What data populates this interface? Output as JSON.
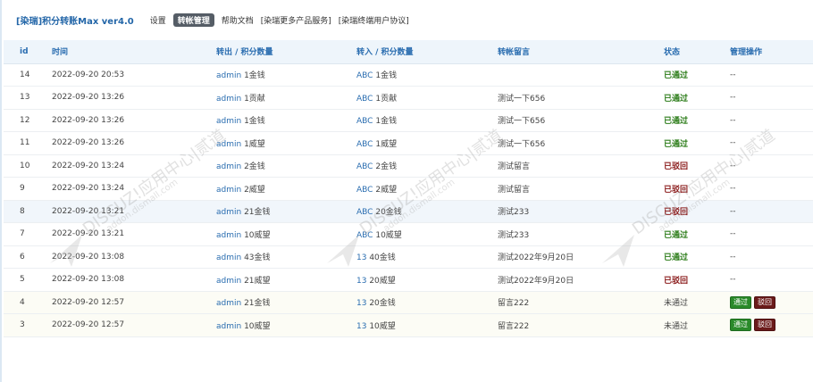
{
  "header": {
    "title": "[染瑞]积分转账Max ver4.0",
    "nav": [
      {
        "label": "设置",
        "active": false
      },
      {
        "label": "转帐管理",
        "active": true
      },
      {
        "label": "帮助文档",
        "active": false
      },
      {
        "label": "[染瑞更多产品服务]",
        "active": false
      },
      {
        "label": "[染瑞终端用户协议]",
        "active": false
      }
    ]
  },
  "table": {
    "columns": [
      "id",
      "时间",
      "转出 / 积分数量",
      "转入 / 积分数量",
      "转帐留言",
      "状态",
      "管理操作"
    ],
    "rows": [
      {
        "id": "14",
        "time": "2022-09-20 20:53",
        "from_user": "admin",
        "from_amount": "1金钱",
        "to_user": "ABC",
        "to_amount": "1金钱",
        "message": "",
        "status": "已通过",
        "status_type": "pass",
        "action": "--"
      },
      {
        "id": "13",
        "time": "2022-09-20 13:26",
        "from_user": "admin",
        "from_amount": "1贡献",
        "to_user": "ABC",
        "to_amount": "1贡献",
        "message": "测试一下656",
        "status": "已通过",
        "status_type": "pass",
        "action": "--"
      },
      {
        "id": "12",
        "time": "2022-09-20 13:26",
        "from_user": "admin",
        "from_amount": "1金钱",
        "to_user": "ABC",
        "to_amount": "1金钱",
        "message": "测试一下656",
        "status": "已通过",
        "status_type": "pass",
        "action": "--"
      },
      {
        "id": "11",
        "time": "2022-09-20 13:26",
        "from_user": "admin",
        "from_amount": "1威望",
        "to_user": "ABC",
        "to_amount": "1威望",
        "message": "测试一下656",
        "status": "已通过",
        "status_type": "pass",
        "action": "--"
      },
      {
        "id": "10",
        "time": "2022-09-20 13:24",
        "from_user": "admin",
        "from_amount": "2金钱",
        "to_user": "ABC",
        "to_amount": "2金钱",
        "message": "测试留言",
        "status": "已驳回",
        "status_type": "reject",
        "action": "--"
      },
      {
        "id": "9",
        "time": "2022-09-20 13:24",
        "from_user": "admin",
        "from_amount": "2威望",
        "to_user": "ABC",
        "to_amount": "2威望",
        "message": "测试留言",
        "status": "已驳回",
        "status_type": "reject",
        "action": "--"
      },
      {
        "id": "8",
        "time": "2022-09-20 13:21",
        "from_user": "admin",
        "from_amount": "21金钱",
        "to_user": "ABC",
        "to_amount": "20金钱",
        "message": "测试233",
        "status": "已驳回",
        "status_type": "reject",
        "action": "--"
      },
      {
        "id": "7",
        "time": "2022-09-20 13:21",
        "from_user": "admin",
        "from_amount": "10威望",
        "to_user": "ABC",
        "to_amount": "10威望",
        "message": "测试233",
        "status": "已通过",
        "status_type": "pass",
        "action": "--"
      },
      {
        "id": "6",
        "time": "2022-09-20 13:08",
        "from_user": "admin",
        "from_amount": "43金钱",
        "to_user": "13",
        "to_amount": "40金钱",
        "message": "测试2022年9月20日",
        "status": "已通过",
        "status_type": "pass",
        "action": "--"
      },
      {
        "id": "5",
        "time": "2022-09-20 13:08",
        "from_user": "admin",
        "from_amount": "21威望",
        "to_user": "13",
        "to_amount": "20威望",
        "message": "测试2022年9月20日",
        "status": "已驳回",
        "status_type": "reject",
        "action": "--"
      },
      {
        "id": "4",
        "time": "2022-09-20 12:57",
        "from_user": "admin",
        "from_amount": "21金钱",
        "to_user": "13",
        "to_amount": "20金钱",
        "message": "留言222",
        "status": "未通过",
        "status_type": "pending",
        "action": "buttons"
      },
      {
        "id": "3",
        "time": "2022-09-20 12:57",
        "from_user": "admin",
        "from_amount": "10威望",
        "to_user": "13",
        "to_amount": "10威望",
        "message": "留言222",
        "status": "未通过",
        "status_type": "pending",
        "action": "buttons"
      }
    ],
    "approve_label": "通过",
    "reject_label": "驳回"
  },
  "watermark": {
    "line1": "DISCUZ!应用中心|贰道",
    "line2": "addon.dismall.com"
  },
  "colors": {
    "accent": "#2a6db0",
    "pass": "#2d7d1a",
    "reject": "#8a1a1a",
    "approve_button": "#2a8a2a",
    "reject_button": "#6b1a1a"
  }
}
